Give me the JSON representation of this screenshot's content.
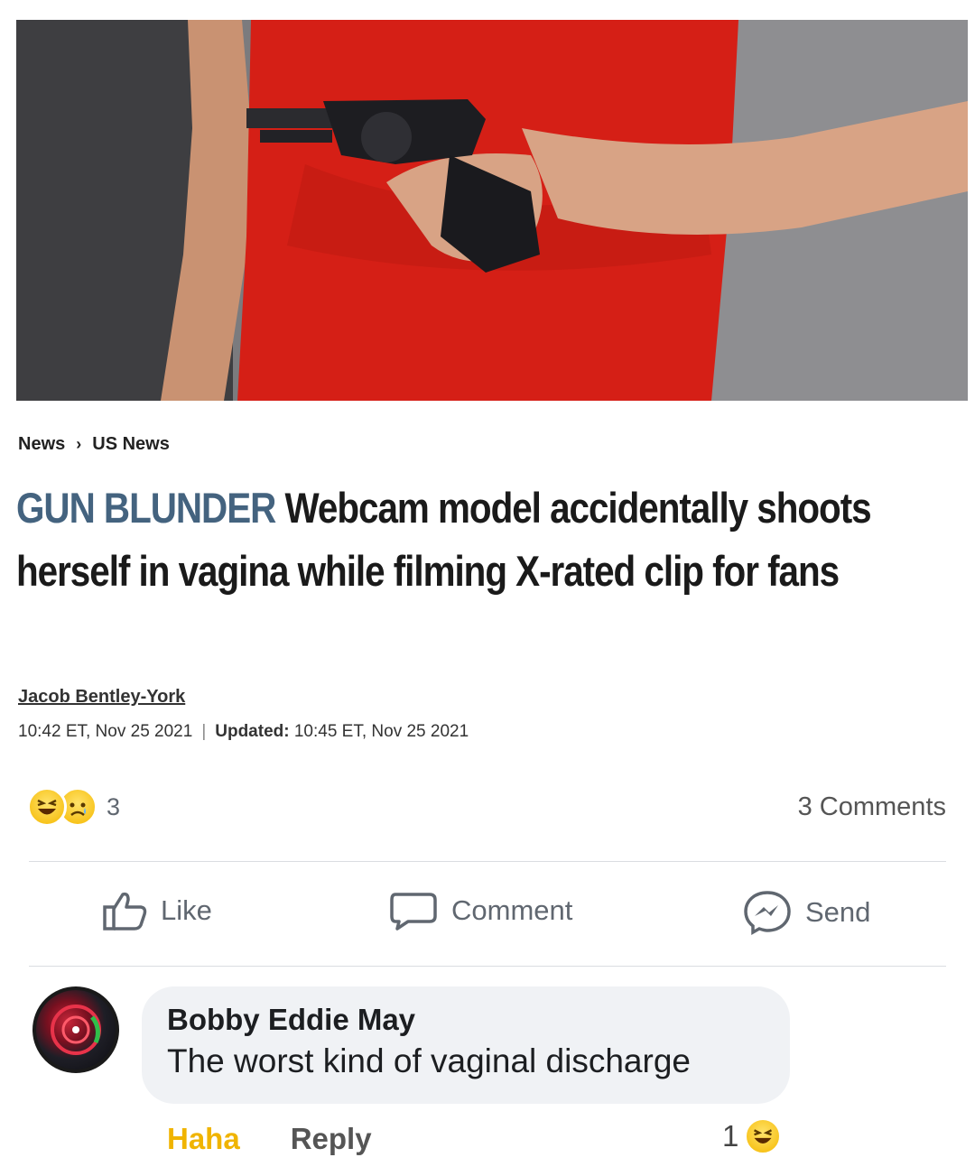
{
  "breadcrumb": {
    "section": "News",
    "subsection": "US News"
  },
  "headline": {
    "kicker": "GUN BLUNDER",
    "text": "Webcam model accidentally shoots herself in vagina while filming X-rated clip for fans"
  },
  "byline": {
    "author": "Jacob Bentley-York",
    "published": "10:42 ET, Nov 25 2021",
    "updated_label": "Updated:",
    "updated": "10:45 ET, Nov 25 2021"
  },
  "reactions": {
    "types": [
      "haha",
      "sad"
    ],
    "count": "3"
  },
  "comments_count": "3 Comments",
  "actions": {
    "like": "Like",
    "comment": "Comment",
    "send": "Send"
  },
  "comment": {
    "author": "Bobby Eddie May",
    "text": "The worst kind of vaginal discharge",
    "reaction_label": "Haha",
    "reply_label": "Reply",
    "reaction_count": "1"
  },
  "colors": {
    "kicker": "#44637f",
    "haha": "#f0b400",
    "facebook_gray": "#606770"
  }
}
